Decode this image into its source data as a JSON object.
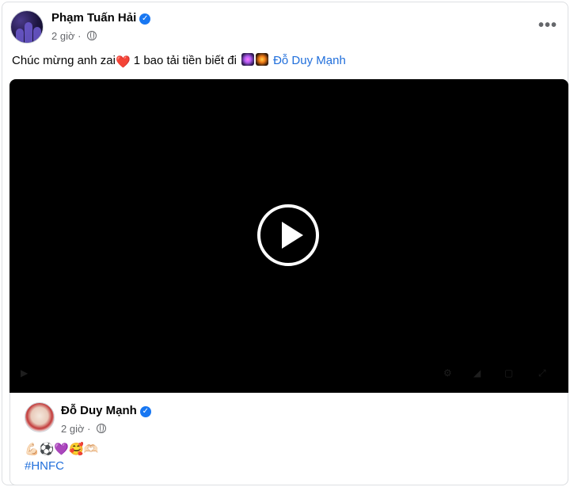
{
  "post": {
    "author": "Phạm Tuấn Hải",
    "time": "2 giờ",
    "more_label": "•••",
    "caption_text": "Chúc mừng anh zai",
    "caption_heart": "❤️",
    "caption_text_2": " 1 bao tải tiền biết đi ",
    "mention": "Đỗ Duy Mạnh"
  },
  "icons": {
    "verified": "verified-badge-icon",
    "globe": "globe-icon",
    "more": "more-horizontal-icon",
    "play": "play-icon",
    "fireworks": [
      "fireworks-purple-icon",
      "fireworks-orange-icon"
    ]
  },
  "shared": {
    "author": "Đỗ Duy Mạnh",
    "time": "2 giờ",
    "emojis": "💪🏻⚽💜🥰🫶🏻",
    "hashtag": "#HNFC"
  },
  "colors": {
    "link": "#216fdb",
    "verified": "#1877f2",
    "video_bg": "#000000",
    "meta": "#65676b"
  }
}
